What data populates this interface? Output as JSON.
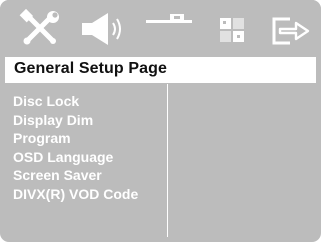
{
  "icon_bar": {
    "icons": [
      "general-setup-icon",
      "audio-setup-icon",
      "video-setup-icon",
      "preference-setup-icon",
      "exit-setup-icon"
    ]
  },
  "page": {
    "title": "General Setup Page"
  },
  "menu": {
    "items": [
      {
        "label": "Disc Lock"
      },
      {
        "label": "Display Dim"
      },
      {
        "label": "Program"
      },
      {
        "label": "OSD Language"
      },
      {
        "label": "Screen Saver"
      },
      {
        "label": "DIVX(R) VOD Code"
      }
    ]
  },
  "colors": {
    "panel_bg": "#bcbcbc",
    "title_bg": "#ffffff",
    "menu_text": "#ffffff",
    "title_text": "#111111"
  }
}
